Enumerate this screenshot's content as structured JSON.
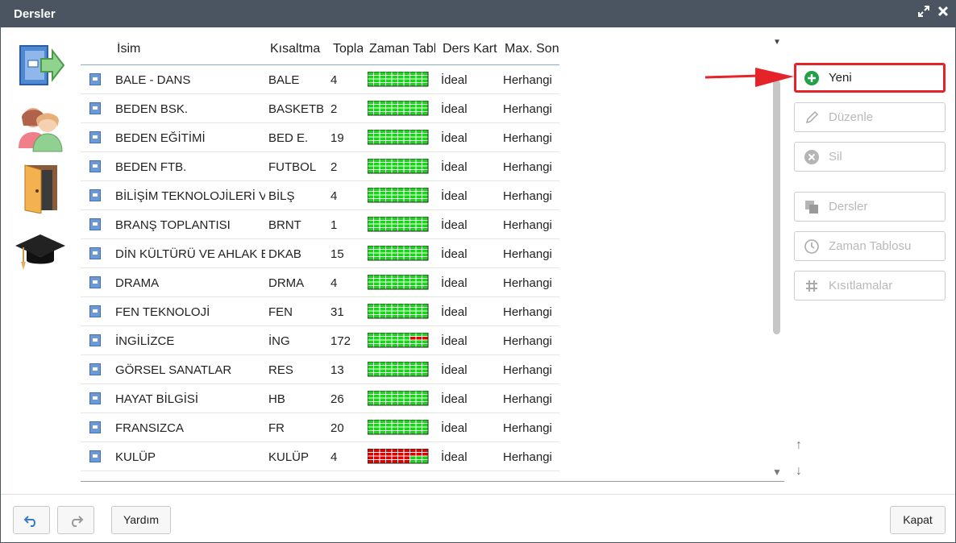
{
  "window": {
    "title": "Dersler",
    "maximize_icon": "maximize-icon",
    "close_icon": "close-icon"
  },
  "left_nav": [
    {
      "name": "lessons-export-icon"
    },
    {
      "name": "teachers-icon"
    },
    {
      "name": "classroom-door-icon"
    },
    {
      "name": "graduation-cap-icon"
    }
  ],
  "grid": {
    "columns": [
      "İsim",
      "Kısaltma",
      "Toplam",
      "Zaman Tablosu",
      "Ders Kartı",
      "Max. Sonraki"
    ],
    "rows": [
      {
        "name": "BALE - DANS",
        "short": "BALE",
        "total": "4",
        "card": "İdeal",
        "max": "Herhangi",
        "tt": "green"
      },
      {
        "name": "BEDEN BSK.",
        "short": "BASKETBOL",
        "total": "2",
        "card": "İdeal",
        "max": "Herhangi",
        "tt": "green"
      },
      {
        "name": "BEDEN EĞİTİMİ",
        "short": "BED E.",
        "total": "19",
        "card": "İdeal",
        "max": "Herhangi",
        "tt": "green"
      },
      {
        "name": "BEDEN FTB.",
        "short": "FUTBOL",
        "total": "2",
        "card": "İdeal",
        "max": "Herhangi",
        "tt": "green"
      },
      {
        "name": "BİLİŞİM TEKNOLOJİLERİ VE YAZILIM",
        "short": "BİLŞ",
        "total": "4",
        "card": "İdeal",
        "max": "Herhangi",
        "tt": "green"
      },
      {
        "name": "BRANŞ TOPLANTISI",
        "short": "BRNT",
        "total": "1",
        "card": "İdeal",
        "max": "Herhangi",
        "tt": "green"
      },
      {
        "name": "DİN KÜLTÜRÜ VE AHLAK BİLGİSİ",
        "short": "DKAB",
        "total": "15",
        "card": "İdeal",
        "max": "Herhangi",
        "tt": "green"
      },
      {
        "name": "DRAMA",
        "short": "DRMA",
        "total": "4",
        "card": "İdeal",
        "max": "Herhangi",
        "tt": "green"
      },
      {
        "name": "FEN TEKNOLOJİ",
        "short": "FEN",
        "total": "31",
        "card": "İdeal",
        "max": "Herhangi",
        "tt": "green"
      },
      {
        "name": "İNGİLİZCE",
        "short": "İNG",
        "total": "172",
        "card": "İdeal",
        "max": "Herhangi",
        "tt": "green-red-corner"
      },
      {
        "name": "GÖRSEL SANATLAR",
        "short": "RES",
        "total": "13",
        "card": "İdeal",
        "max": "Herhangi",
        "tt": "green"
      },
      {
        "name": "HAYAT BİLGİSİ",
        "short": "HB",
        "total": "26",
        "card": "İdeal",
        "max": "Herhangi",
        "tt": "green"
      },
      {
        "name": "FRANSIZCA",
        "short": "FR",
        "total": "20",
        "card": "İdeal",
        "max": "Herhangi",
        "tt": "green"
      },
      {
        "name": "KULÜP",
        "short": "KULÜP",
        "total": "4",
        "card": "İdeal",
        "max": "Herhangi",
        "tt": "mostly-red"
      }
    ],
    "colors": {
      "tt_green": "#17d617",
      "tt_red": "#e00000",
      "header_line": "#8aaad0"
    }
  },
  "actions": {
    "new": "Yeni",
    "edit": "Düzenle",
    "delete": "Sil",
    "lessons": "Dersler",
    "timetable": "Zaman Tablosu",
    "constraints": "Kısıtlamalar"
  },
  "footer": {
    "help": "Yardım",
    "close": "Kapat"
  }
}
